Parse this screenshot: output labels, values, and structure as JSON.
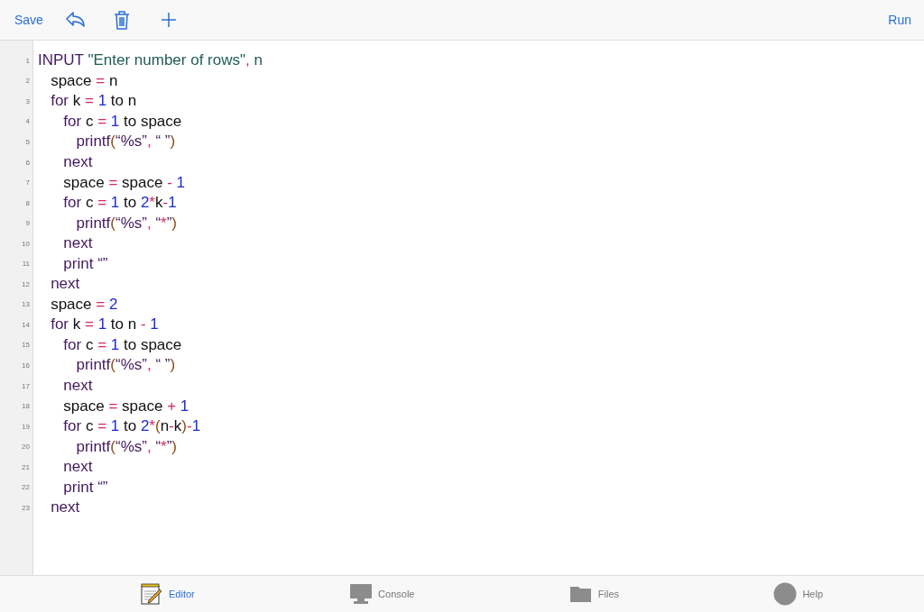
{
  "toolbar": {
    "save": "Save",
    "run": "Run"
  },
  "lines": [
    {
      "number": "1",
      "tokens": [
        {
          "text": "INPUT ",
          "kind": "keyword"
        },
        {
          "text": "\"Enter number of rows\"",
          "kind": "string"
        },
        {
          "text": ",",
          "kind": "op"
        },
        {
          "text": " n",
          "kind": "string"
        }
      ]
    },
    {
      "number": "2",
      "tokens": [
        {
          "text": "   space ",
          "kind": "ident"
        },
        {
          "text": "=",
          "kind": "op"
        },
        {
          "text": " n",
          "kind": "ident"
        }
      ]
    },
    {
      "number": "3",
      "tokens": [
        {
          "text": "   for ",
          "kind": "keyword"
        },
        {
          "text": "k ",
          "kind": "ident"
        },
        {
          "text": "=",
          "kind": "op"
        },
        {
          "text": " 1",
          "kind": "number"
        },
        {
          "text": " to ",
          "kind": "ident"
        },
        {
          "text": "n",
          "kind": "ident"
        }
      ]
    },
    {
      "number": "4",
      "tokens": [
        {
          "text": "      for ",
          "kind": "keyword"
        },
        {
          "text": "c ",
          "kind": "ident"
        },
        {
          "text": "=",
          "kind": "op"
        },
        {
          "text": " 1",
          "kind": "number"
        },
        {
          "text": " to space",
          "kind": "ident"
        }
      ]
    },
    {
      "number": "5",
      "tokens": [
        {
          "text": "         printf",
          "kind": "keyword"
        },
        {
          "text": "(",
          "kind": "paren"
        },
        {
          "text": "“%s”",
          "kind": "keyword"
        },
        {
          "text": ",",
          "kind": "op"
        },
        {
          "text": " “ ”",
          "kind": "keyword"
        },
        {
          "text": ")",
          "kind": "paren"
        }
      ]
    },
    {
      "number": "6",
      "tokens": [
        {
          "text": "      next",
          "kind": "keyword"
        }
      ]
    },
    {
      "number": "7",
      "tokens": [
        {
          "text": "      space ",
          "kind": "ident"
        },
        {
          "text": "=",
          "kind": "op"
        },
        {
          "text": " space ",
          "kind": "ident"
        },
        {
          "text": "-",
          "kind": "op"
        },
        {
          "text": " 1",
          "kind": "number"
        }
      ]
    },
    {
      "number": "8",
      "tokens": [
        {
          "text": "      for ",
          "kind": "keyword"
        },
        {
          "text": "c ",
          "kind": "ident"
        },
        {
          "text": "=",
          "kind": "op"
        },
        {
          "text": " 1",
          "kind": "number"
        },
        {
          "text": " to ",
          "kind": "ident"
        },
        {
          "text": "2",
          "kind": "number"
        },
        {
          "text": "*",
          "kind": "op"
        },
        {
          "text": "k",
          "kind": "ident"
        },
        {
          "text": "-",
          "kind": "op"
        },
        {
          "text": "1",
          "kind": "number"
        }
      ]
    },
    {
      "number": "9",
      "tokens": [
        {
          "text": "         printf",
          "kind": "keyword"
        },
        {
          "text": "(",
          "kind": "paren"
        },
        {
          "text": "“%s”",
          "kind": "keyword"
        },
        {
          "text": ",",
          "kind": "op"
        },
        {
          "text": " “",
          "kind": "keyword"
        },
        {
          "text": "*",
          "kind": "op"
        },
        {
          "text": "”",
          "kind": "keyword"
        },
        {
          "text": ")",
          "kind": "paren"
        }
      ]
    },
    {
      "number": "10",
      "tokens": [
        {
          "text": "      next",
          "kind": "keyword"
        }
      ]
    },
    {
      "number": "11",
      "tokens": [
        {
          "text": "      print ",
          "kind": "keyword"
        },
        {
          "text": "“”",
          "kind": "keyword"
        }
      ]
    },
    {
      "number": "12",
      "tokens": [
        {
          "text": "   next",
          "kind": "keyword"
        }
      ]
    },
    {
      "number": "13",
      "tokens": [
        {
          "text": "   space ",
          "kind": "ident"
        },
        {
          "text": "=",
          "kind": "op"
        },
        {
          "text": " 2",
          "kind": "number"
        }
      ]
    },
    {
      "number": "14",
      "tokens": [
        {
          "text": "   for ",
          "kind": "keyword"
        },
        {
          "text": "k ",
          "kind": "ident"
        },
        {
          "text": "=",
          "kind": "op"
        },
        {
          "text": " 1",
          "kind": "number"
        },
        {
          "text": " to ",
          "kind": "ident"
        },
        {
          "text": "n ",
          "kind": "ident"
        },
        {
          "text": "-",
          "kind": "op"
        },
        {
          "text": " 1",
          "kind": "number"
        }
      ]
    },
    {
      "number": "15",
      "tokens": [
        {
          "text": "      for ",
          "kind": "keyword"
        },
        {
          "text": "c ",
          "kind": "ident"
        },
        {
          "text": "=",
          "kind": "op"
        },
        {
          "text": " 1",
          "kind": "number"
        },
        {
          "text": " to space",
          "kind": "ident"
        }
      ]
    },
    {
      "number": "16",
      "tokens": [
        {
          "text": "         printf",
          "kind": "keyword"
        },
        {
          "text": "(",
          "kind": "paren"
        },
        {
          "text": "“%s”",
          "kind": "keyword"
        },
        {
          "text": ",",
          "kind": "op"
        },
        {
          "text": " “ ”",
          "kind": "keyword"
        },
        {
          "text": ")",
          "kind": "paren"
        }
      ]
    },
    {
      "number": "17",
      "tokens": [
        {
          "text": "      next",
          "kind": "keyword"
        }
      ]
    },
    {
      "number": "18",
      "tokens": [
        {
          "text": "      space ",
          "kind": "ident"
        },
        {
          "text": "=",
          "kind": "op"
        },
        {
          "text": " space ",
          "kind": "ident"
        },
        {
          "text": "+",
          "kind": "op"
        },
        {
          "text": " 1",
          "kind": "number"
        }
      ]
    },
    {
      "number": "19",
      "tokens": [
        {
          "text": "      for ",
          "kind": "keyword"
        },
        {
          "text": "c ",
          "kind": "ident"
        },
        {
          "text": "=",
          "kind": "op"
        },
        {
          "text": " 1",
          "kind": "number"
        },
        {
          "text": " to ",
          "kind": "ident"
        },
        {
          "text": "2",
          "kind": "number"
        },
        {
          "text": "*",
          "kind": "op"
        },
        {
          "text": "(",
          "kind": "paren"
        },
        {
          "text": "n",
          "kind": "ident"
        },
        {
          "text": "-",
          "kind": "op"
        },
        {
          "text": "k",
          "kind": "ident"
        },
        {
          "text": ")",
          "kind": "paren"
        },
        {
          "text": "-",
          "kind": "op"
        },
        {
          "text": "1",
          "kind": "number"
        }
      ]
    },
    {
      "number": "20",
      "tokens": [
        {
          "text": "         printf",
          "kind": "keyword"
        },
        {
          "text": "(",
          "kind": "paren"
        },
        {
          "text": "“%s”",
          "kind": "keyword"
        },
        {
          "text": ",",
          "kind": "op"
        },
        {
          "text": " “",
          "kind": "keyword"
        },
        {
          "text": "*",
          "kind": "op"
        },
        {
          "text": "”",
          "kind": "keyword"
        },
        {
          "text": ")",
          "kind": "paren"
        }
      ]
    },
    {
      "number": "21",
      "tokens": [
        {
          "text": "      next",
          "kind": "keyword"
        }
      ]
    },
    {
      "number": "22",
      "tokens": [
        {
          "text": "      print ",
          "kind": "keyword"
        },
        {
          "text": "“”",
          "kind": "keyword"
        }
      ]
    },
    {
      "number": "23",
      "tokens": [
        {
          "text": "   next",
          "kind": "keyword"
        }
      ]
    }
  ],
  "tabs": [
    {
      "label": "Editor",
      "kind": "editor",
      "selected": true
    },
    {
      "label": "Console",
      "kind": "console",
      "selected": false
    },
    {
      "label": "Files",
      "kind": "files",
      "selected": false
    },
    {
      "label": "Help",
      "kind": "help",
      "selected": false
    }
  ]
}
